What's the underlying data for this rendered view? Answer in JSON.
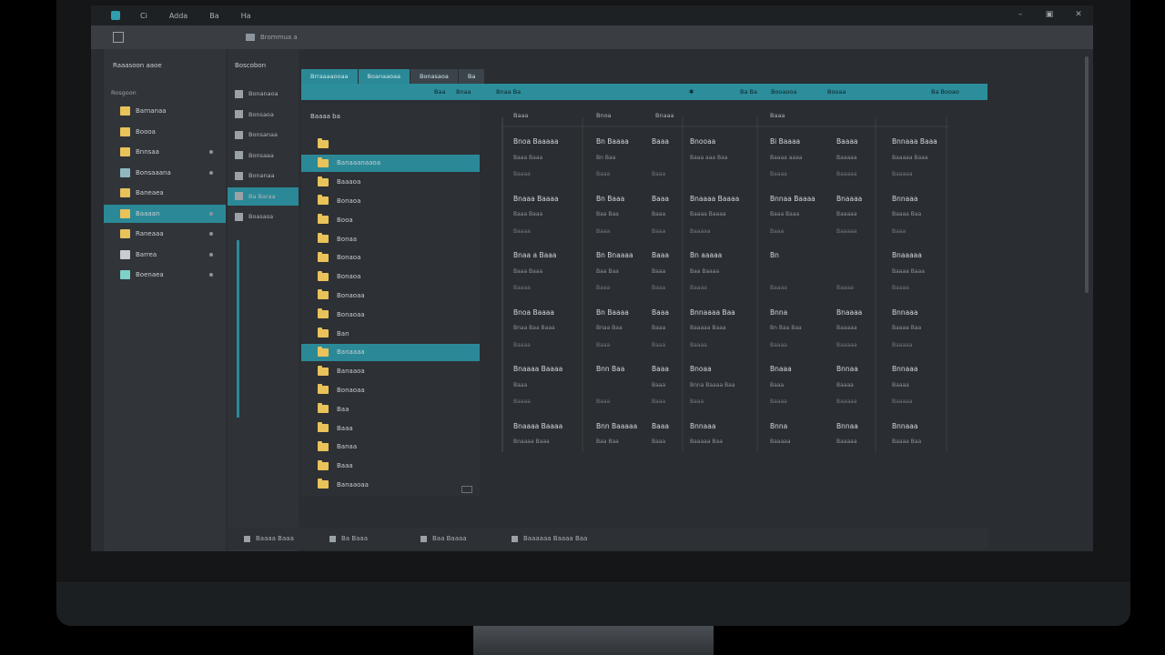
{
  "titlebar": {
    "menu": [
      "Ci",
      "Adda",
      "Ba",
      "Ha"
    ],
    "controls": [
      "–",
      "▣",
      "✕"
    ]
  },
  "addressbar": {
    "path": "Brommua a"
  },
  "sidebar": {
    "header": "Raaasoon aaoe",
    "section": "Rosgoon",
    "items": [
      {
        "label": "Barnanaa",
        "icon": "folder-icon",
        "color": "#e9c25a",
        "dot": false,
        "active": false
      },
      {
        "label": "Boooa",
        "icon": "folder-icon",
        "color": "#e9c25a",
        "dot": false,
        "active": false
      },
      {
        "label": "Bnnsaa",
        "icon": "folder-icon",
        "color": "#e9c25a",
        "dot": true,
        "active": false
      },
      {
        "label": "Bonsaaana",
        "icon": "image-icon",
        "color": "#8fb8c2",
        "dot": true,
        "active": false
      },
      {
        "label": "Baneaea",
        "icon": "folder-icon",
        "color": "#e9c25a",
        "dot": false,
        "active": false
      },
      {
        "label": "Baaaan",
        "icon": "folder-icon",
        "color": "#e9c25a",
        "dot": true,
        "active": true
      },
      {
        "label": "Raneaaa",
        "icon": "folder-icon",
        "color": "#e9c25a",
        "dot": true,
        "active": false
      },
      {
        "label": "Barrea",
        "icon": "image-icon",
        "color": "#c8cdd1",
        "dot": true,
        "active": false
      },
      {
        "label": "Boenaea",
        "icon": "image-icon",
        "color": "#7fd0c8",
        "dot": true,
        "active": false
      }
    ]
  },
  "panel2": {
    "header": "Boscobon",
    "items": [
      {
        "label": "Bonanaoa",
        "active": false
      },
      {
        "label": "Bonsaoa",
        "active": false
      },
      {
        "label": "Bonsanaa",
        "active": false
      },
      {
        "label": "Bonsaaa",
        "active": false
      },
      {
        "label": "Bonanaa",
        "active": false
      },
      {
        "label": "Ba Baraa",
        "active": true
      },
      {
        "label": "Boasasa",
        "active": false
      }
    ]
  },
  "tabs": [
    {
      "label": "Brraaaaooaa",
      "active": true
    },
    {
      "label": "Boanaaoaa",
      "active": true
    },
    {
      "label": "Bonasaoa",
      "active": false
    },
    {
      "label": "Ba",
      "active": false
    }
  ],
  "toolbar": {
    "items": [
      "Baa",
      "Bnaa",
      "Bnaa Ba",
      "Ba Ba",
      "Booaooa",
      "Booaa",
      "Ba Booao"
    ]
  },
  "tree": {
    "header": "Baaaa ba",
    "items": [
      {
        "label": "",
        "active": false
      },
      {
        "label": "Banaaanaaoa",
        "active": true
      },
      {
        "label": "Baaaoa",
        "active": false
      },
      {
        "label": "Bonaoa",
        "active": false
      },
      {
        "label": "Booa",
        "active": false
      },
      {
        "label": "Bonaa",
        "active": false
      },
      {
        "label": "Bonaoa",
        "active": false
      },
      {
        "label": "Bonaoa",
        "active": false
      },
      {
        "label": "Bonaoaa",
        "active": false
      },
      {
        "label": "Bonaoaa",
        "active": false
      },
      {
        "label": "Ban",
        "active": false
      },
      {
        "label": "Banaaaa",
        "active": true
      },
      {
        "label": "Banaaoa",
        "active": false
      },
      {
        "label": "Bonaoaa",
        "active": false
      },
      {
        "label": "Baa",
        "active": false
      },
      {
        "label": "Baaa",
        "active": false
      },
      {
        "label": "Banaa",
        "active": false
      },
      {
        "label": "Baaa",
        "active": false
      },
      {
        "label": "Banaaoaa",
        "active": false
      }
    ]
  },
  "grid": {
    "headers": [
      "Baaa",
      "Bnoa",
      "Bnaaa",
      "Baaa"
    ],
    "rows": [
      {
        "cells": [
          "Bnoa Baaaaa",
          "Bn Baaaa",
          "Baaa",
          "Bnooaa",
          "Bi Baaaa",
          "Baaaa",
          "Bnnaaa Baaa"
        ],
        "sub": [
          "Baaa Baaa",
          "Bn Baa",
          "",
          "Baaa aaa Baa",
          "Baaaa aaaa",
          "Baaaaa",
          "Baaaaa Baaa"
        ],
        "sub2": [
          "Baaaa",
          "Baaa",
          "Baaa",
          "",
          "Baaaa",
          "Baaaaa",
          "Baaaaa"
        ]
      },
      {
        "cells": [
          "Bnaaa Baaaa",
          "Bn Baaa",
          "Baaa",
          "Bnaaaa Baaaa",
          "Bnnaa Baaaa",
          "Bnaaaa",
          "Bnnaaa"
        ],
        "sub": [
          "Baaa Baaa",
          "Baa Baa",
          "Baaa",
          "Baaaa Baaaa",
          "Baaa Baaa",
          "Baaaaa",
          "Baaaa Baa"
        ],
        "sub2": [
          "Baaaa",
          "Baaa",
          "Baaa",
          "Baaaaa",
          "Baaa",
          "Baaaaa",
          "Baaa"
        ]
      },
      {
        "cells": [
          "Bnaa a Baaa",
          "Bn Bnaaaa",
          "Baaa",
          "Bn aaaaa",
          "Bn",
          "",
          "Bnaaaaa"
        ],
        "sub": [
          "Baaa Baaa",
          "Baa Baa",
          "Baaa",
          "Baa Baaaa",
          "",
          "",
          "Baaaa Baaa"
        ],
        "sub2": [
          "Baaaa",
          "Baaa",
          "Baaa",
          "Baaaa",
          "Baaaa",
          "Baaaa",
          "Baaaa"
        ]
      },
      {
        "cells": [
          "Bnoa Baaaa",
          "Bn Baaaa",
          "Baaa",
          "Bnnaaaa Baa",
          "Bnna",
          "Bnaaaa",
          "Bnnaaa"
        ],
        "sub": [
          "Bnaa Baa Baaa",
          "Bnaa Baa",
          "Baaa",
          "Baaaaa Baaa",
          "Bn Baa Baa",
          "Baaaaa",
          "Baaaa Baa"
        ],
        "sub2": [
          "Baaaa",
          "Baaa",
          "Baaa",
          "Baaaa",
          "Baaaa",
          "Baaaaa",
          "Baaaaa"
        ]
      },
      {
        "cells": [
          "Bnaaaa Baaaa",
          "Bnn Baa",
          "Baaa",
          "Bnoaa",
          "Bnaaa",
          "Bnnaa",
          "Bnnaaa"
        ],
        "sub": [
          "Baaa",
          "",
          "Baaa",
          "Bnna Baaaa Baa",
          "Baaa",
          "Baaaa",
          "Baaaa"
        ],
        "sub2": [
          "Baaaa",
          "Baaa",
          "Baaa",
          "Baaa",
          "Baaaa",
          "Baaaaa",
          "Baaaaa"
        ]
      },
      {
        "cells": [
          "Bnaaaa Baaaa",
          "Bnn Baaaaa",
          "Baaa",
          "Bnnaaa",
          "Bnna",
          "Bnnaa",
          "Bnnaaa"
        ],
        "sub": [
          "Bnaaaa Baaa",
          "Baa Baa",
          "Baaa",
          "Baaaaa Baa",
          "Baaaaa",
          "Baaaaa",
          "Baaaa Baa"
        ],
        "sub2": [
          "",
          "",
          "",
          "",
          "",
          "",
          ""
        ]
      }
    ]
  },
  "statusbar": {
    "items": [
      "Baaaa Baaa",
      "Ba Baaa",
      "Baa Baaaa",
      "Baaaaaa Baaaa Baa"
    ]
  }
}
